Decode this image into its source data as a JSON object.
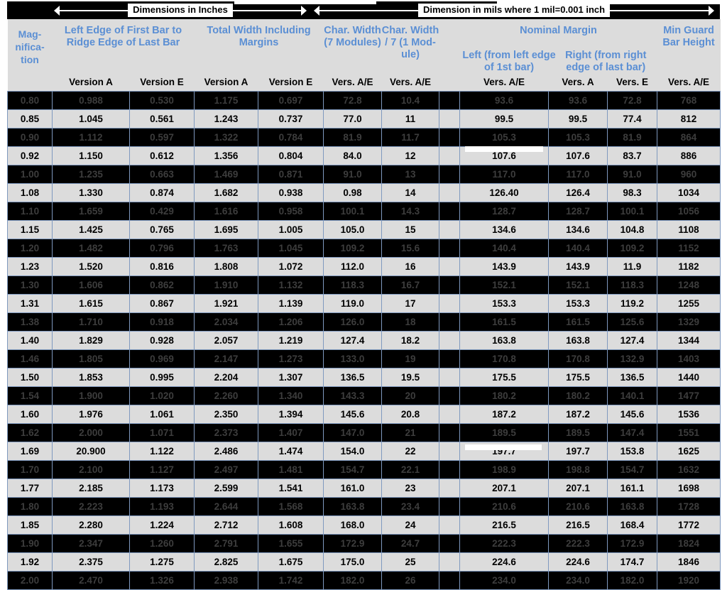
{
  "spans": [
    {
      "label": "Dimensions in Inches"
    },
    {
      "label": "Dimension in mils where 1 mil=0.001 inch"
    }
  ],
  "header": {
    "groups": [
      {
        "name": "magnification",
        "label": "Mag-\nnifica-\ntion",
        "lines": [
          "Mag-",
          "nifica-",
          "tion"
        ]
      },
      {
        "name": "left-edge-first-to-ridge-last",
        "label": "Left Edge of First Bar to Ridge Edge of Last Bar"
      },
      {
        "name": "total-width-including-margins",
        "label": "Total Width Including Margins"
      },
      {
        "name": "char-width-7-modules",
        "label": "Char. Width (7 Modules)"
      },
      {
        "name": "char-width-div-7-one-module",
        "label": "Char. Width / 7 (1 Mod-ule)"
      },
      {
        "name": "spacer",
        "label": ""
      },
      {
        "name": "nominal-margin",
        "label": "Nominal Margin"
      },
      {
        "name": "nominal-margin-left",
        "label": "Left (from left edge of 1st bar)"
      },
      {
        "name": "nominal-margin-right",
        "label": "Right (from right edge of last bar)"
      },
      {
        "name": "min-guard-bar-height",
        "label": "Min Guard Bar Height"
      }
    ],
    "subheaders": [
      "",
      "Version A",
      "Version E",
      "Version A",
      "Version E",
      "Vers. A/E",
      "Vers. A/E",
      "",
      "Vers. A/E",
      "Vers. A",
      "Vers. E",
      "Vers. A/E"
    ]
  },
  "table": {
    "columns": [
      "Magnification",
      "Left Edge of First Bar to Ridge Edge of Last Bar - Version A",
      "Left Edge of First Bar to Ridge Edge of Last Bar - Version E",
      "Total Width Including Margins - Version A",
      "Total Width Including Margins - Version E",
      "Char. Width (7 Modules) - Vers. A/E",
      "Char. Width / 7 (1 Module) - Vers. A/E",
      "",
      "Nominal Margin Left (from left edge of 1st bar) - Vers. A/E",
      "Nominal Margin Right (from right edge of last bar) - Vers. A",
      "Nominal Margin Right (from right edge of last bar) - Vers. E",
      "Min Guard Bar Height - Vers. A/E"
    ],
    "rows": [
      {
        "style": "dark",
        "cells": [
          "0.80",
          "0.988",
          "0.530",
          "1.175",
          "0.697",
          "72.8",
          "10.4",
          "",
          "93.6",
          "93.6",
          "72.8",
          "768"
        ]
      },
      {
        "style": "light",
        "cells": [
          "0.85",
          "1.045",
          "0.561",
          "1.243",
          "0.737",
          "77.0",
          "11",
          "",
          "99.5",
          "99.5",
          "77.4",
          "812"
        ]
      },
      {
        "style": "dark",
        "cells": [
          "0.90",
          "1.112",
          "0.597",
          "1.322",
          "0.784",
          "81.9",
          "11.7",
          "",
          "105.3",
          "105.3",
          "81.9",
          "864"
        ]
      },
      {
        "style": "light",
        "cells": [
          "0.92",
          "1.150",
          "0.612",
          "1.356",
          "0.804",
          "84.0",
          "12",
          "",
          "107.6",
          "107.6",
          "83.7",
          "886"
        ]
      },
      {
        "style": "dark",
        "cells": [
          "1.00",
          "1.235",
          "0.663",
          "1.469",
          "0.871",
          "91.0",
          "13",
          "",
          "117.0",
          "117.0",
          "91.0",
          "960"
        ]
      },
      {
        "style": "light",
        "cells": [
          "1.08",
          "1.330",
          "0.874",
          "1.682",
          "0.938",
          "0.98",
          "14",
          "",
          "126.40",
          "126.4",
          "98.3",
          "1034"
        ]
      },
      {
        "style": "dark",
        "cells": [
          "1.10",
          "1.659",
          "0.429",
          "1.616",
          "0.958",
          "100.1",
          "14.3",
          "",
          "128.7",
          "128.7",
          "100.1",
          "1056"
        ]
      },
      {
        "style": "light",
        "cells": [
          "1.15",
          "1.425",
          "0.765",
          "1.695",
          "1.005",
          "105.0",
          "15",
          "",
          "134.6",
          "134.6",
          "104.8",
          "1108"
        ]
      },
      {
        "style": "dark",
        "cells": [
          "1.20",
          "1.482",
          "0.796",
          "1.763",
          "1.045",
          "109.2",
          "15.6",
          "",
          "140.4",
          "140.4",
          "109.2",
          "1152"
        ]
      },
      {
        "style": "light",
        "cells": [
          "1.23",
          "1.520",
          "0.816",
          "1.808",
          "1.072",
          "112.0",
          "16",
          "",
          "143.9",
          "143.9",
          "11.9",
          "1182"
        ]
      },
      {
        "style": "dark",
        "cells": [
          "1.30",
          "1.606",
          "0.862",
          "1.910",
          "1.132",
          "118.3",
          "16.7",
          "",
          "152.1",
          "152.1",
          "118.3",
          "1248"
        ]
      },
      {
        "style": "light",
        "cells": [
          "1.31",
          "1.615",
          "0.867",
          "1.921",
          "1.139",
          "119.0",
          "17",
          "",
          "153.3",
          "153.3",
          "119.2",
          "1255"
        ]
      },
      {
        "style": "dark",
        "cells": [
          "1.38",
          "1.710",
          "0.918",
          "2.034",
          "1.206",
          "126.0",
          "18",
          "",
          "161.5",
          "161.5",
          "125.6",
          "1329"
        ]
      },
      {
        "style": "light",
        "cells": [
          "1.40",
          "1.829",
          "0.928",
          "2.057",
          "1.219",
          "127.4",
          "18.2",
          "",
          "163.8",
          "163.8",
          "127.4",
          "1344"
        ]
      },
      {
        "style": "dark",
        "cells": [
          "1.46",
          "1.805",
          "0.969",
          "2.147",
          "1.273",
          "133.0",
          "19",
          "",
          "170.8",
          "170.8",
          "132.9",
          "1403"
        ]
      },
      {
        "style": "light",
        "cells": [
          "1.50",
          "1.853",
          "0.995",
          "2.204",
          "1.307",
          "136.5",
          "19.5",
          "",
          "175.5",
          "175.5",
          "136.5",
          "1440"
        ]
      },
      {
        "style": "dark",
        "cells": [
          "1.54",
          "1.900",
          "1.020",
          "2.260",
          "1.340",
          "143.3",
          "20",
          "",
          "180.2",
          "180.2",
          "140.1",
          "1477"
        ]
      },
      {
        "style": "light",
        "cells": [
          "1.60",
          "1.976",
          "1.061",
          "2.350",
          "1.394",
          "145.6",
          "20.8",
          "",
          "187.2",
          "187.2",
          "145.6",
          "1536"
        ]
      },
      {
        "style": "dark",
        "cells": [
          "1.62",
          "2.000",
          "1.071",
          "2.373",
          "1.407",
          "147.0",
          "21",
          "",
          "189.5",
          "189.5",
          "147.4",
          "1551"
        ]
      },
      {
        "style": "light",
        "cells": [
          "1.69",
          "20.900",
          "1.122",
          "2.486",
          "1.474",
          "154.0",
          "22",
          "",
          "197.7",
          "197.7",
          "153.8",
          "1625"
        ]
      },
      {
        "style": "dark",
        "cells": [
          "1.70",
          "2.100",
          "1.127",
          "2.497",
          "1.481",
          "154.7",
          "22.1",
          "",
          "198.9",
          "198.8",
          "154.7",
          "1632"
        ]
      },
      {
        "style": "light",
        "cells": [
          "1.77",
          "2.185",
          "1.173",
          "2.599",
          "1.541",
          "161.0",
          "23",
          "",
          "207.1",
          "207.1",
          "161.1",
          "1698"
        ]
      },
      {
        "style": "dark",
        "cells": [
          "1.80",
          "2.223",
          "1.193",
          "2.644",
          "1.568",
          "163.8",
          "23.4",
          "",
          "210.6",
          "210.6",
          "163.8",
          "1728"
        ]
      },
      {
        "style": "light",
        "cells": [
          "1.85",
          "2.280",
          "1.224",
          "2.712",
          "1.608",
          "168.0",
          "24",
          "",
          "216.5",
          "216.5",
          "168.4",
          "1772"
        ]
      },
      {
        "style": "dark",
        "cells": [
          "1.90",
          "2.347",
          "1.260",
          "2.791",
          "1.655",
          "172.9",
          "24.7",
          "",
          "222.3",
          "222.3",
          "172.9",
          "1824"
        ]
      },
      {
        "style": "light",
        "cells": [
          "1.92",
          "2.375",
          "1.275",
          "2.825",
          "1.675",
          "175.0",
          "25",
          "",
          "224.6",
          "224.6",
          "174.7",
          "1846"
        ]
      },
      {
        "style": "dark",
        "cells": [
          "2.00",
          "2.470",
          "1.326",
          "2.938",
          "1.742",
          "182.0",
          "26",
          "",
          "234.0",
          "234.0",
          "182.0",
          "1920"
        ]
      }
    ]
  },
  "colors": {
    "header_accent": "#5b8fd4",
    "header_bg": "#dcdcdc",
    "row_light_bg": "#dcdcdc",
    "row_dark_bg": "#000000",
    "row_dark_text": "#3d3d3d",
    "grid_line": "#7f99bf",
    "span_bar_bg": "#000000"
  }
}
